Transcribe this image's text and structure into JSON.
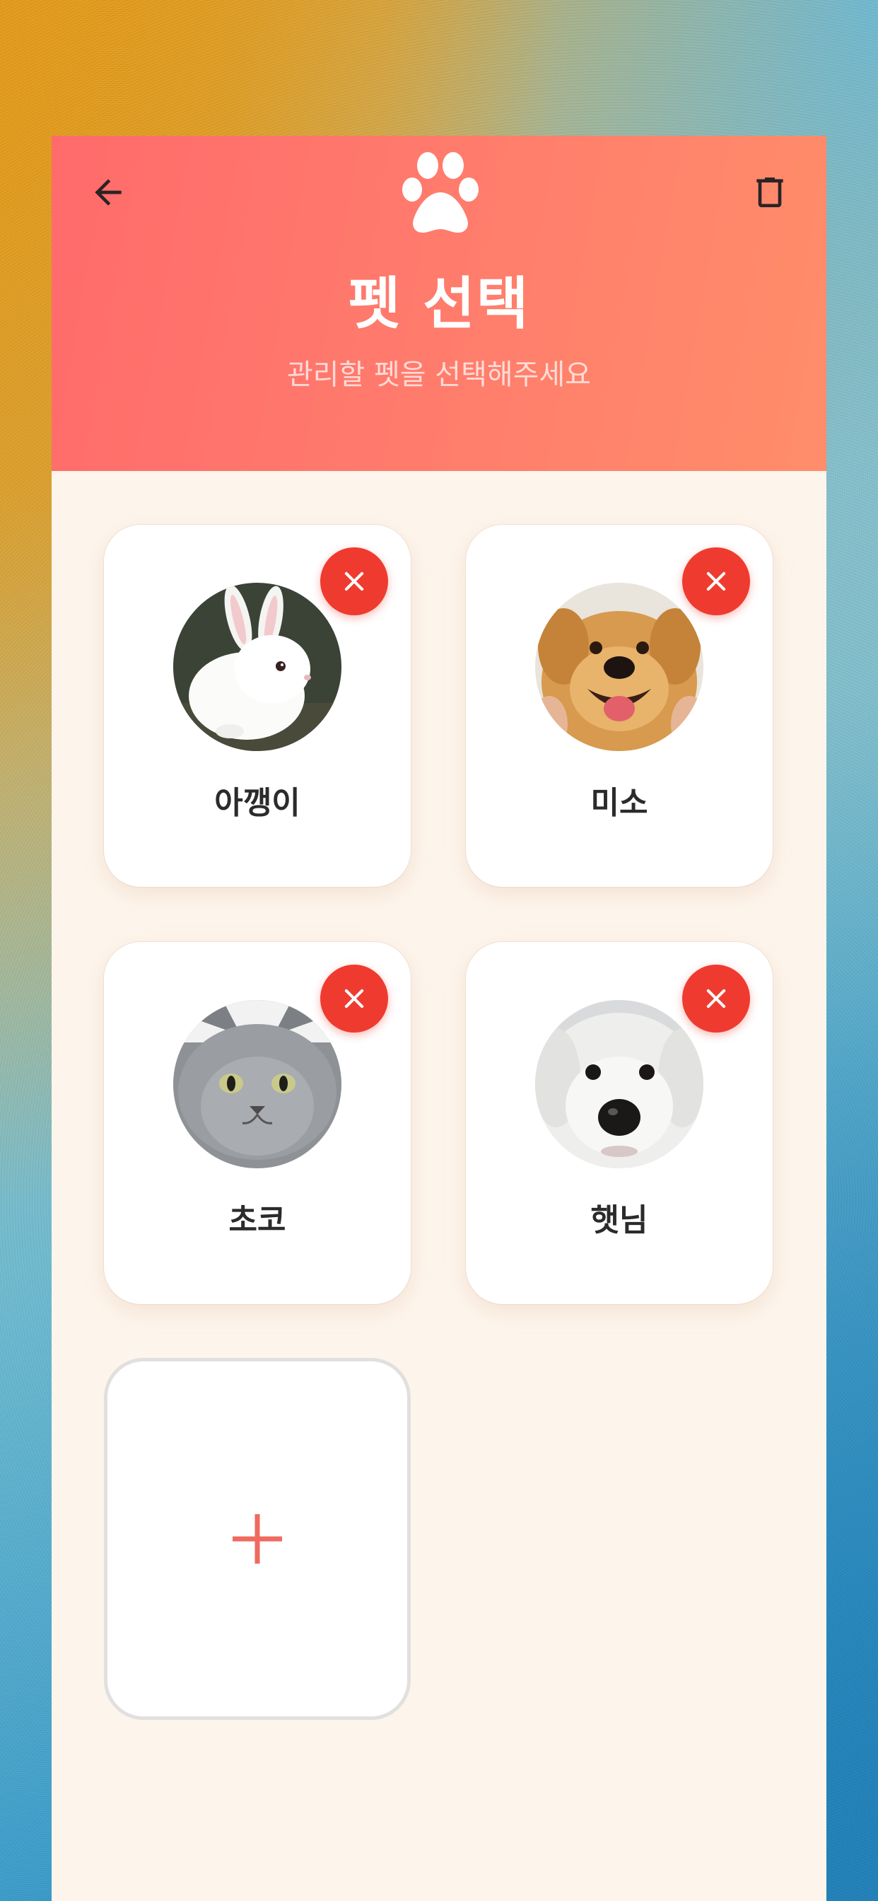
{
  "header": {
    "title": "펫 선택",
    "subtitle": "관리할 펫을 선택해주세요",
    "back_icon": "arrow-left-icon",
    "delete_icon": "trash-icon",
    "logo_icon": "paw-icon"
  },
  "pets": [
    {
      "name": "아깽이",
      "photo": "white rabbit"
    },
    {
      "name": "미소",
      "photo": "smiling golden retriever"
    },
    {
      "name": "초코",
      "photo": "grey cat"
    },
    {
      "name": "햇님",
      "photo": "white fluffy dog"
    }
  ],
  "add_card": {
    "icon": "plus-icon"
  },
  "colors": {
    "header_start": "#ff6b6b",
    "header_end": "#ff8d6a",
    "background": "#fdf5ec",
    "remove_button": "#ef3b2f",
    "add_plus": "#f06a5f",
    "name_text": "#2b2b2b"
  }
}
